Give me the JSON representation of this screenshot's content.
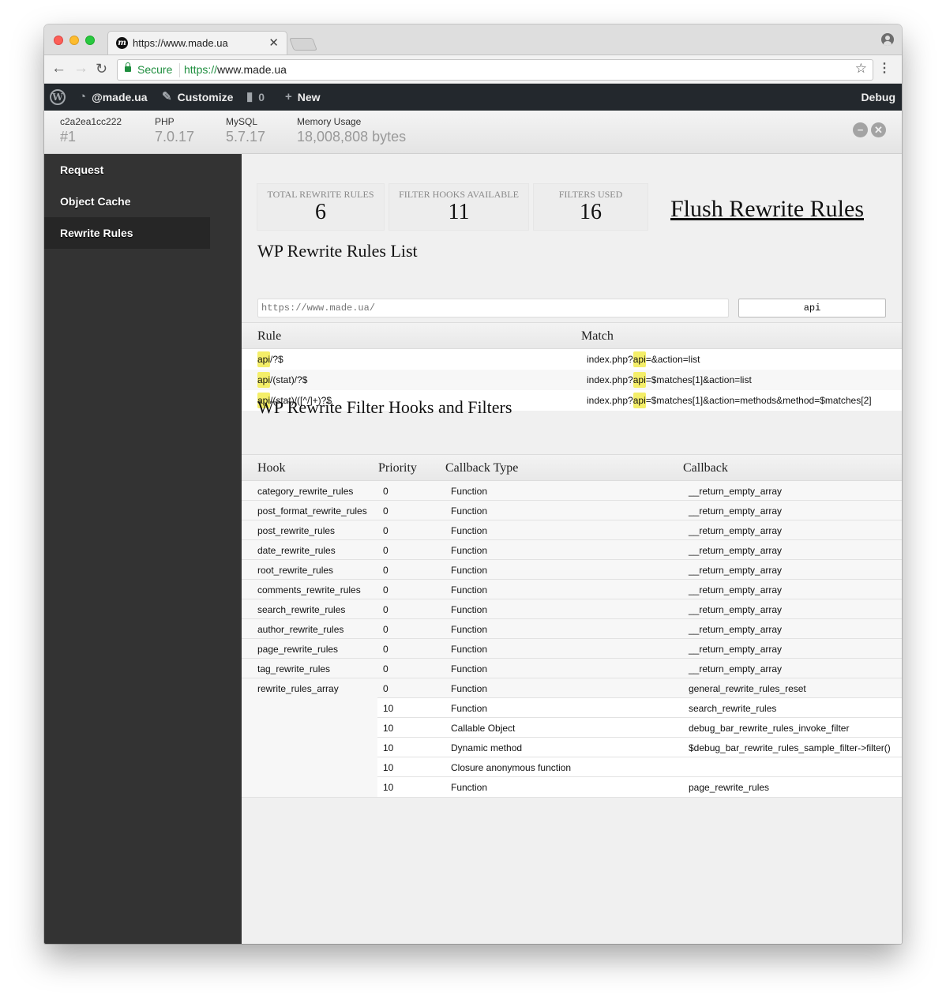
{
  "browser": {
    "tab_title": "https://www.made.ua",
    "tab_favicon": "m",
    "secure_label": "Secure",
    "url_scheme": "https://",
    "url_host": "www.made.ua"
  },
  "adminbar": {
    "site": "@made.ua",
    "customize": "Customize",
    "comments_count": "0",
    "new": "New",
    "debug": "Debug"
  },
  "debug_header": {
    "items": [
      {
        "label": "c2a2ea1cc222",
        "value": "#1"
      },
      {
        "label": "PHP",
        "value": "7.0.17"
      },
      {
        "label": "MySQL",
        "value": "5.7.17"
      },
      {
        "label": "Memory Usage",
        "value": "18,008,808 bytes"
      }
    ]
  },
  "sidebar": {
    "items": [
      {
        "label": "Request",
        "active": false
      },
      {
        "label": "Object Cache",
        "active": false
      },
      {
        "label": "Rewrite Rules",
        "active": true
      }
    ]
  },
  "stats": [
    {
      "label": "Total Rewrite Rules",
      "value": "6"
    },
    {
      "label": "Filter Hooks Available",
      "value": "11"
    },
    {
      "label": "Filters Used",
      "value": "16"
    }
  ],
  "flush_label": "Flush Rewrite Rules",
  "rules_section": {
    "title": "WP Rewrite Rules List",
    "url_placeholder": "https://www.made.ua/",
    "filter_value": "api",
    "columns": [
      "Rule",
      "Match"
    ],
    "rows": [
      {
        "rule_hl": "api",
        "rule_rest": "/?$",
        "match_pre": "index.php?",
        "match_hl": "api",
        "match_rest": "=&action=list"
      },
      {
        "rule_hl": "api",
        "rule_rest": "/(stat)/?$",
        "match_pre": "index.php?",
        "match_hl": "api",
        "match_rest": "=$matches[1]&action=list"
      },
      {
        "rule_hl": "api",
        "rule_rest": "/(stat)/([^/]+)?$",
        "match_pre": "index.php?",
        "match_hl": "api",
        "match_rest": "=$matches[1]&action=methods&method=$matches[2]"
      }
    ]
  },
  "hooks_section": {
    "title": "WP Rewrite Filter Hooks and Filters",
    "columns": [
      "Hook",
      "Priority",
      "Callback Type",
      "Callback"
    ],
    "rows": [
      {
        "hook": "category_rewrite_rules",
        "priority": "0",
        "type": "Function",
        "callback": "__return_empty_array"
      },
      {
        "hook": "post_format_rewrite_rules",
        "priority": "0",
        "type": "Function",
        "callback": "__return_empty_array"
      },
      {
        "hook": "post_rewrite_rules",
        "priority": "0",
        "type": "Function",
        "callback": "__return_empty_array"
      },
      {
        "hook": "date_rewrite_rules",
        "priority": "0",
        "type": "Function",
        "callback": "__return_empty_array"
      },
      {
        "hook": "root_rewrite_rules",
        "priority": "0",
        "type": "Function",
        "callback": "__return_empty_array"
      },
      {
        "hook": "comments_rewrite_rules",
        "priority": "0",
        "type": "Function",
        "callback": "__return_empty_array"
      },
      {
        "hook": "search_rewrite_rules",
        "priority": "0",
        "type": "Function",
        "callback": "__return_empty_array"
      },
      {
        "hook": "author_rewrite_rules",
        "priority": "0",
        "type": "Function",
        "callback": "__return_empty_array"
      },
      {
        "hook": "page_rewrite_rules",
        "priority": "0",
        "type": "Function",
        "callback": "__return_empty_array"
      },
      {
        "hook": "tag_rewrite_rules",
        "priority": "0",
        "type": "Function",
        "callback": "__return_empty_array"
      }
    ],
    "group": {
      "hook": "rewrite_rules_array",
      "entries": [
        {
          "priority": "0",
          "type": "Function",
          "callback": "general_rewrite_rules_reset"
        },
        {
          "priority": "10",
          "type": "Function",
          "callback": "search_rewrite_rules"
        },
        {
          "priority": "10",
          "type": "Callable Object",
          "callback": "debug_bar_rewrite_rules_invoke_filter"
        },
        {
          "priority": "10",
          "type": "Dynamic method",
          "callback": "$debug_bar_rewrite_rules_sample_filter->filter()"
        },
        {
          "priority": "10",
          "type": "Closure anonymous function",
          "callback": ""
        },
        {
          "priority": "10",
          "type": "Function",
          "callback": "page_rewrite_rules"
        }
      ]
    }
  }
}
